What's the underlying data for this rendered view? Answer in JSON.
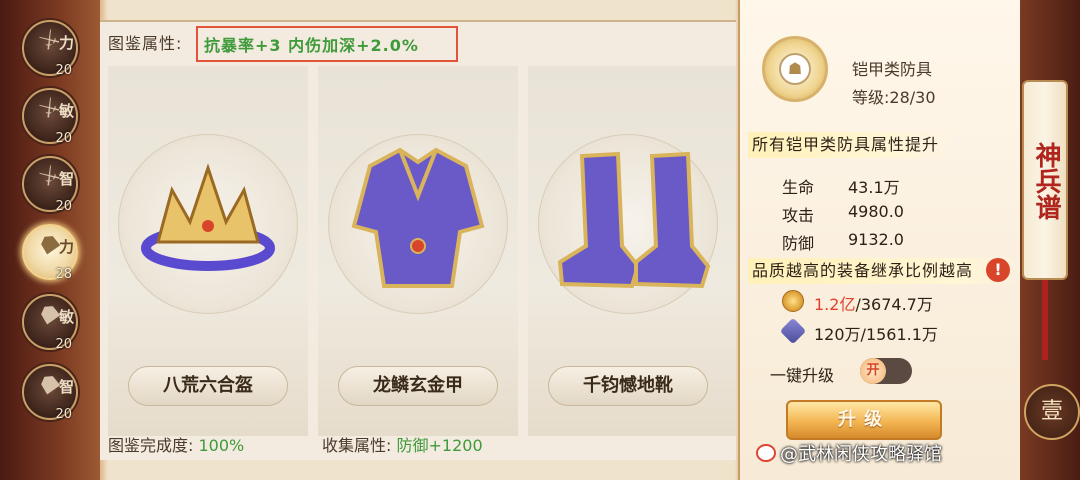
{
  "categories": [
    {
      "char": "力",
      "level": "20",
      "active": false
    },
    {
      "char": "敏",
      "level": "20",
      "active": false
    },
    {
      "char": "智",
      "level": "20",
      "active": false
    },
    {
      "char": "力",
      "level": "28",
      "active": true
    },
    {
      "char": "敏",
      "level": "20",
      "active": false
    },
    {
      "char": "智",
      "level": "20",
      "active": false
    }
  ],
  "main": {
    "attr_label": "图鉴属性:",
    "attr_value": "抗暴率+3  内伤加深+2.0%",
    "cards": [
      {
        "name": "八荒六合盔"
      },
      {
        "name": "龙鳞玄金甲"
      },
      {
        "name": "千钧憾地靴"
      }
    ],
    "completion_label": "图鉴完成度:",
    "completion_value": "100%",
    "collect_label": "收集属性:",
    "collect_value": "防御+1200"
  },
  "info": {
    "type": "铠甲类防具",
    "level": "等级:28/30",
    "bonus_title": "所有铠甲类防具属性提升",
    "stats": [
      {
        "label": "生命",
        "value": "43.1万"
      },
      {
        "label": "攻击",
        "value": "4980.0"
      },
      {
        "label": "防御",
        "value": "9132.0"
      }
    ],
    "inherit_text": "品质越高的装备继承比例越高",
    "warn_icon": "!",
    "costs": [
      {
        "icon": "coin-icon",
        "need": "1.2亿",
        "have": "/3674.7万"
      },
      {
        "icon": "crystal-icon",
        "need": "120万",
        "have": "/1561.1万"
      }
    ],
    "onekey_label": "一键升级",
    "toggle_label": "开",
    "upgrade_label": "升级"
  },
  "side": {
    "scroll_title": "神兵谱",
    "page_label": "壹"
  },
  "watermark": "@武林闲侠攻略驿馆"
}
